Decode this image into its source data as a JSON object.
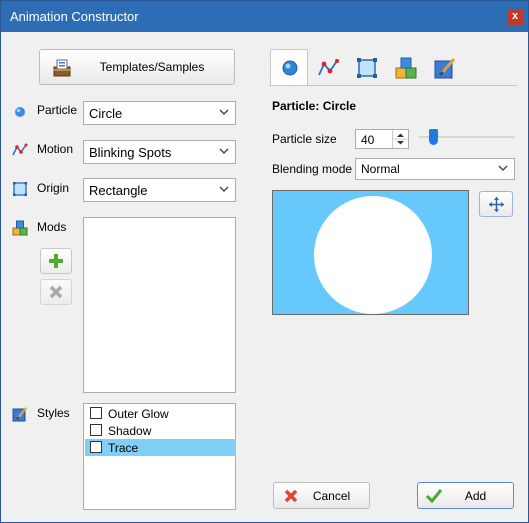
{
  "window": {
    "title": "Animation Constructor",
    "close_glyph": "x"
  },
  "left": {
    "templates_button": "Templates/Samples",
    "particle": {
      "label": "Particle",
      "value": "Circle"
    },
    "motion": {
      "label": "Motion",
      "value": "Blinking Spots"
    },
    "origin": {
      "label": "Origin",
      "value": "Rectangle"
    },
    "mods": {
      "label": "Mods"
    },
    "styles": {
      "label": "Styles",
      "items": [
        {
          "label": "Outer Glow",
          "checked": false,
          "selected": false
        },
        {
          "label": "Shadow",
          "checked": false,
          "selected": false
        },
        {
          "label": "Trace",
          "checked": false,
          "selected": true
        }
      ]
    }
  },
  "right": {
    "tabs": [
      {
        "icon": "particle-circle-icon",
        "active": true
      },
      {
        "icon": "motion-path-icon",
        "active": false
      },
      {
        "icon": "origin-rectangle-icon",
        "active": false
      },
      {
        "icon": "mods-cubes-icon",
        "active": false
      },
      {
        "icon": "styles-brush-icon",
        "active": false
      }
    ],
    "heading": "Particle: Circle",
    "particle_size": {
      "label": "Particle size",
      "value": "40",
      "slider_fraction": 0.12
    },
    "blending": {
      "label": "Blending mode",
      "value": "Normal"
    },
    "preview": {
      "background": "#67c9fb",
      "shape_color": "#ffffff"
    }
  },
  "footer": {
    "cancel": "Cancel",
    "add": "Add"
  }
}
